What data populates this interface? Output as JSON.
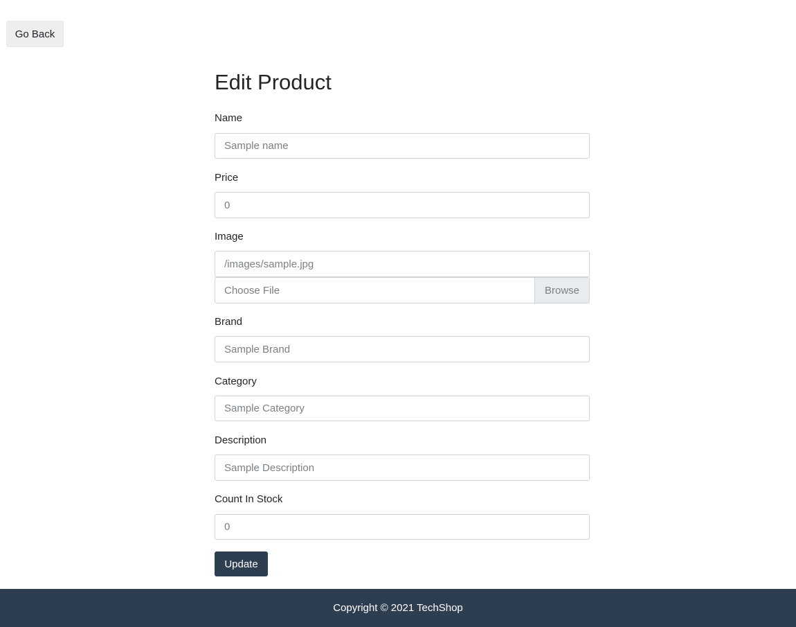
{
  "nav": {
    "go_back_label": "Go Back"
  },
  "form": {
    "title": "Edit Product",
    "name": {
      "label": "Name",
      "placeholder": "Sample name"
    },
    "price": {
      "label": "Price",
      "placeholder": "0"
    },
    "image": {
      "label": "Image",
      "placeholder": "/images/sample.jpg",
      "file_placeholder": "Choose File",
      "browse_label": "Browse"
    },
    "brand": {
      "label": "Brand",
      "placeholder": "Sample Brand"
    },
    "category": {
      "label": "Category",
      "placeholder": "Sample Category"
    },
    "description": {
      "label": "Description",
      "placeholder": "Sample Description"
    },
    "count_in_stock": {
      "label": "Count In Stock",
      "placeholder": "0"
    },
    "submit_label": "Update"
  },
  "footer": {
    "copyright": "Copyright © 2021 TechShop"
  },
  "colors": {
    "primary": "#2c3e50",
    "light_button": "#eceeef",
    "border": "#ced4da"
  }
}
